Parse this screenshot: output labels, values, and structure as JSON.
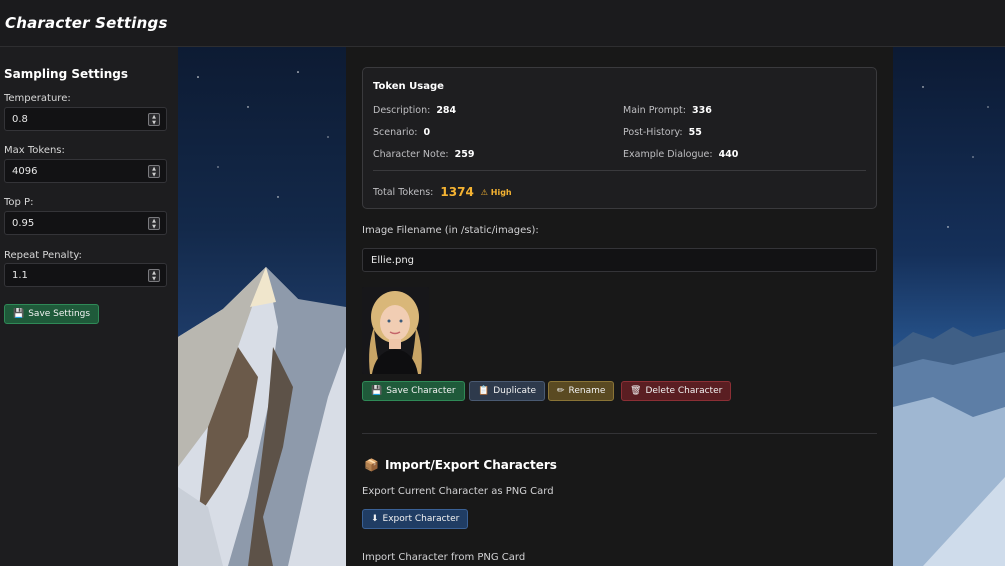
{
  "header": {
    "title": "Character Settings"
  },
  "sidebar": {
    "heading": "Sampling Settings",
    "fields": [
      {
        "label": "Temperature:",
        "value": "0.8"
      },
      {
        "label": "Max Tokens:",
        "value": "4096"
      },
      {
        "label": "Top P:",
        "value": "0.95"
      },
      {
        "label": "Repeat Penalty:",
        "value": "1.1"
      }
    ],
    "save_label": "Save Settings",
    "save_icon": "floppy-disk-icon"
  },
  "tokens": {
    "title": "Token Usage",
    "items": [
      {
        "label": "Description:",
        "value": "284"
      },
      {
        "label": "Scenario:",
        "value": "0"
      },
      {
        "label": "Character Note:",
        "value": "259"
      },
      {
        "label": "Main Prompt:",
        "value": "336"
      },
      {
        "label": "Post-History:",
        "value": "55"
      },
      {
        "label": "Example Dialogue:",
        "value": "440"
      }
    ],
    "total_label": "Total Tokens:",
    "total_value": "1374",
    "warning": "High",
    "warning_color": "#f5b332"
  },
  "image": {
    "label": "Image Filename (in /static/images):",
    "filename": "Ellie.png"
  },
  "actions": {
    "save": "Save Character",
    "duplicate": "Duplicate",
    "rename": "Rename",
    "delete": "Delete Character"
  },
  "import_export": {
    "heading": "Import/Export Characters",
    "export_label": "Export Current Character as PNG Card",
    "export_button": "Export Character",
    "import_label": "Import Character from PNG Card"
  }
}
